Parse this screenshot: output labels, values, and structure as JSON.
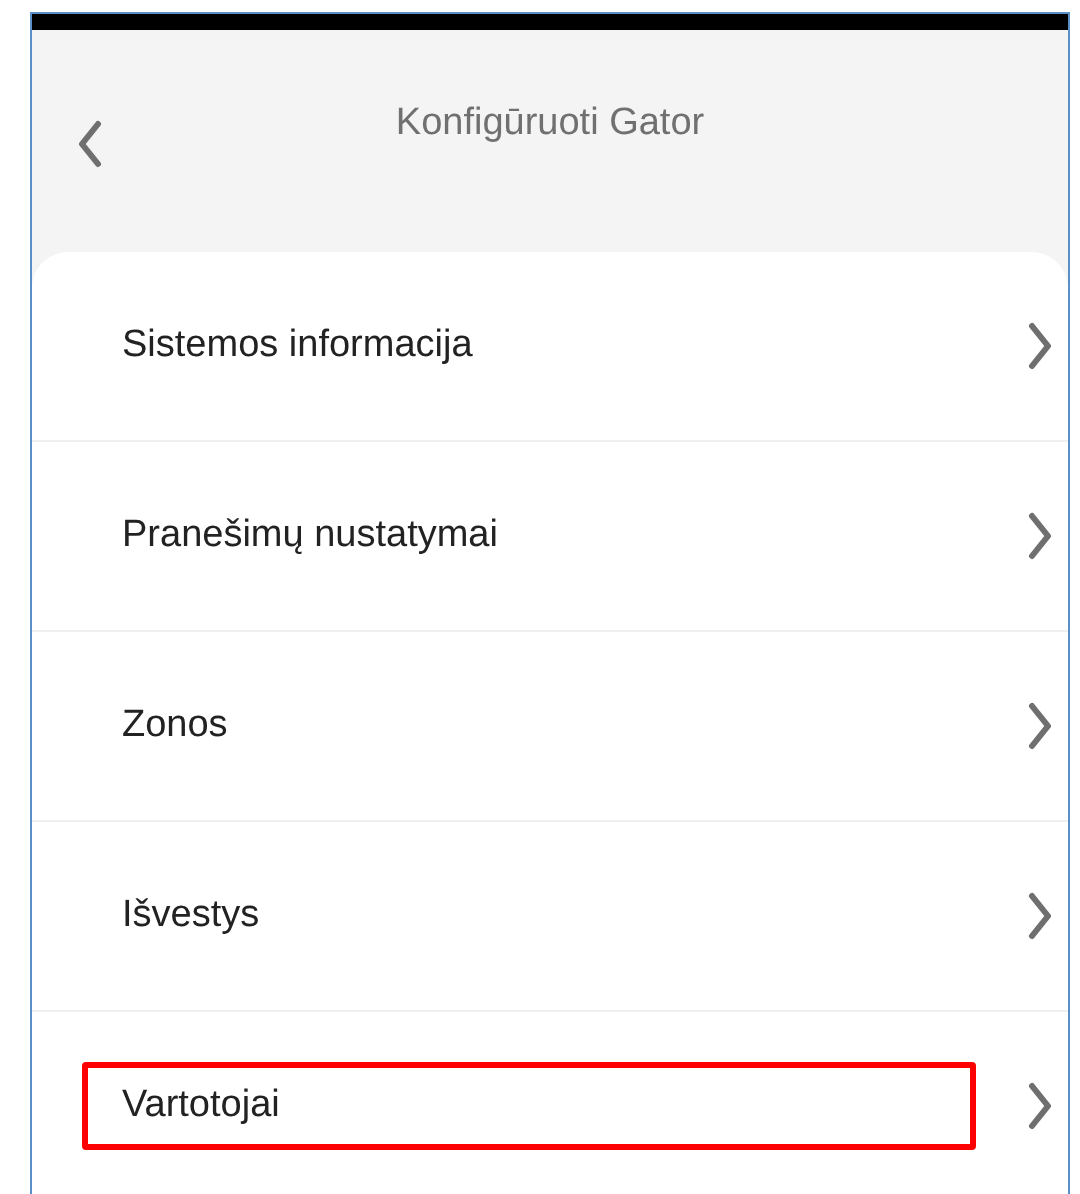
{
  "header": {
    "title": "Konfigūruoti Gator"
  },
  "menu_items": [
    {
      "label": "Sistemos informacija",
      "highlighted": false
    },
    {
      "label": "Pranešimų nustatymai",
      "highlighted": false
    },
    {
      "label": "Zonos",
      "highlighted": false
    },
    {
      "label": "Išvestys",
      "highlighted": false
    },
    {
      "label": "Vartotojai",
      "highlighted": true
    }
  ]
}
